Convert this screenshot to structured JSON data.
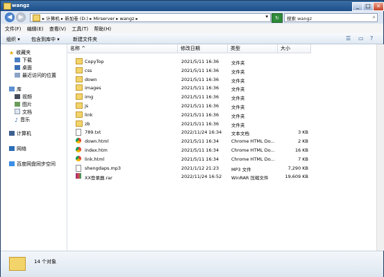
{
  "window": {
    "title": "wangz"
  },
  "address": {
    "crumbs": "▸ 计算机 ▸ 新加卷 (D:) ▸ Mirserver ▸ wangz ▸",
    "search_placeholder": "搜索 wangz"
  },
  "menubar": [
    "文件(F)",
    "编辑(E)",
    "查看(V)",
    "工具(T)",
    "帮助(H)"
  ],
  "toolbar": {
    "organize": "组织 ▾",
    "include": "包含到库中 ▾",
    "new_folder": "新建文件夹"
  },
  "nav": {
    "favorites": "收藏夹",
    "downloads": "下载",
    "desktop": "桌面",
    "recent": "最近访问的位置",
    "libraries": "库",
    "videos": "视频",
    "pictures": "图片",
    "documents": "文档",
    "music": "音乐",
    "computer": "计算机",
    "network": "网络",
    "baidu": "百度网盘同步空间"
  },
  "columns": {
    "name": "名称 ^",
    "date": "修改日期",
    "type": "类型",
    "size": "大小"
  },
  "files": [
    {
      "name": "CopyTop",
      "date": "2021/5/11 16:36",
      "type": "文件夹",
      "size": "",
      "icon": "folder"
    },
    {
      "name": "css",
      "date": "2021/5/11 16:36",
      "type": "文件夹",
      "size": "",
      "icon": "folder"
    },
    {
      "name": "down",
      "date": "2021/5/11 16:36",
      "type": "文件夹",
      "size": "",
      "icon": "folder"
    },
    {
      "name": "images",
      "date": "2021/5/11 16:36",
      "type": "文件夹",
      "size": "",
      "icon": "folder"
    },
    {
      "name": "img",
      "date": "2021/5/11 16:36",
      "type": "文件夹",
      "size": "",
      "icon": "folder"
    },
    {
      "name": "js",
      "date": "2021/5/11 16:36",
      "type": "文件夹",
      "size": "",
      "icon": "folder"
    },
    {
      "name": "link",
      "date": "2021/5/11 16:36",
      "type": "文件夹",
      "size": "",
      "icon": "folder"
    },
    {
      "name": "zb",
      "date": "2021/5/11 16:36",
      "type": "文件夹",
      "size": "",
      "icon": "folder"
    },
    {
      "name": "789.txt",
      "date": "2022/11/24 16:34",
      "type": "文本文档",
      "size": "3 KB",
      "icon": "txt"
    },
    {
      "name": "down.html",
      "date": "2021/5/11 16:34",
      "type": "Chrome HTML Do...",
      "size": "2 KB",
      "icon": "chrome"
    },
    {
      "name": "index.htm",
      "date": "2021/5/11 16:34",
      "type": "Chrome HTML Do...",
      "size": "16 KB",
      "icon": "chrome"
    },
    {
      "name": "link.html",
      "date": "2021/5/11 16:34",
      "type": "Chrome HTML Do...",
      "size": "7 KB",
      "icon": "chrome"
    },
    {
      "name": "shengdaps.mp3",
      "date": "2021/1/12 21:23",
      "type": "MP3 文件",
      "size": "7,290 KB",
      "icon": "mp3"
    },
    {
      "name": "XX登录器.rar",
      "date": "2022/11/24 16:52",
      "type": "WinRAR 压缩文件",
      "size": "19,609 KB",
      "icon": "rar"
    }
  ],
  "status": {
    "count": "14 个对象"
  }
}
